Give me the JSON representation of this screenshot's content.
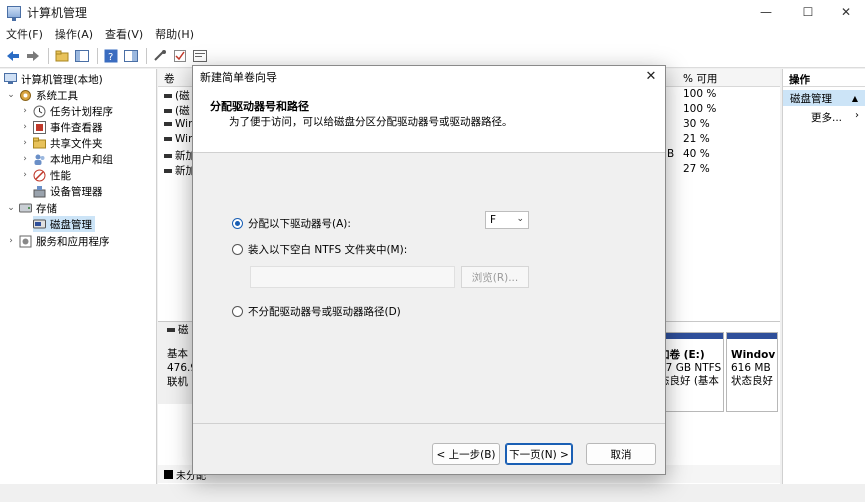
{
  "window": {
    "title": "计算机管理",
    "minimize": "—",
    "maximize": "☐",
    "close": "✕"
  },
  "menu": [
    "文件(F)",
    "操作(A)",
    "查看(V)",
    "帮助(H)"
  ],
  "tree": {
    "root": "计算机管理(本地)",
    "system_tools": "系统工具",
    "task_scheduler": "任务计划程序",
    "event_viewer": "事件查看器",
    "shared_folders": "共享文件夹",
    "local_users": "本地用户和组",
    "performance": "性能",
    "device_manager": "设备管理器",
    "storage": "存储",
    "disk_management": "磁盘管理",
    "services": "服务和应用程序"
  },
  "volumes": {
    "col_volume": "卷",
    "col_percent_free": "% 可用",
    "rows": [
      {
        "name": "(磁",
        "extra": "",
        "percent": "100 %"
      },
      {
        "name": "(磁",
        "extra": "",
        "percent": "100 %"
      },
      {
        "name": "Wir",
        "extra": "",
        "percent": "30 %"
      },
      {
        "name": "Wir",
        "extra": "",
        "percent": "21 %"
      },
      {
        "name": "新加",
        "extra": "B",
        "percent": "40 %"
      },
      {
        "name": "新加",
        "extra": "",
        "percent": "27 %"
      }
    ]
  },
  "disk": {
    "icon_label": "磁",
    "type": "基本",
    "size": "476.9",
    "status": "联机",
    "part_e": {
      "name": "加卷 (E:)",
      "size": "27 GB NTFS",
      "status": "态良好 (基本"
    },
    "part_win": {
      "name": "Windov",
      "size": "616 MB",
      "status": "状态良好"
    }
  },
  "status": {
    "legend_unallocated": "未分配"
  },
  "actions": {
    "title": "操作",
    "section": "磁盘管理",
    "more": "更多..."
  },
  "dialog": {
    "title": "新建简单卷向导",
    "heading": "分配驱动器号和路径",
    "subheading": "为了便于访问，可以给磁盘分区分配驱动器号或驱动器路径。",
    "option_assign": "分配以下驱动器号(A):",
    "option_mount": "装入以下空白 NTFS 文件夹中(M):",
    "option_none": "不分配驱动器号或驱动器路径(D)",
    "drive_letter": "F",
    "path_value": "",
    "browse": "浏览(R)...",
    "back": "< 上一步(B)",
    "next": "下一页(N) >",
    "cancel": "取消"
  }
}
